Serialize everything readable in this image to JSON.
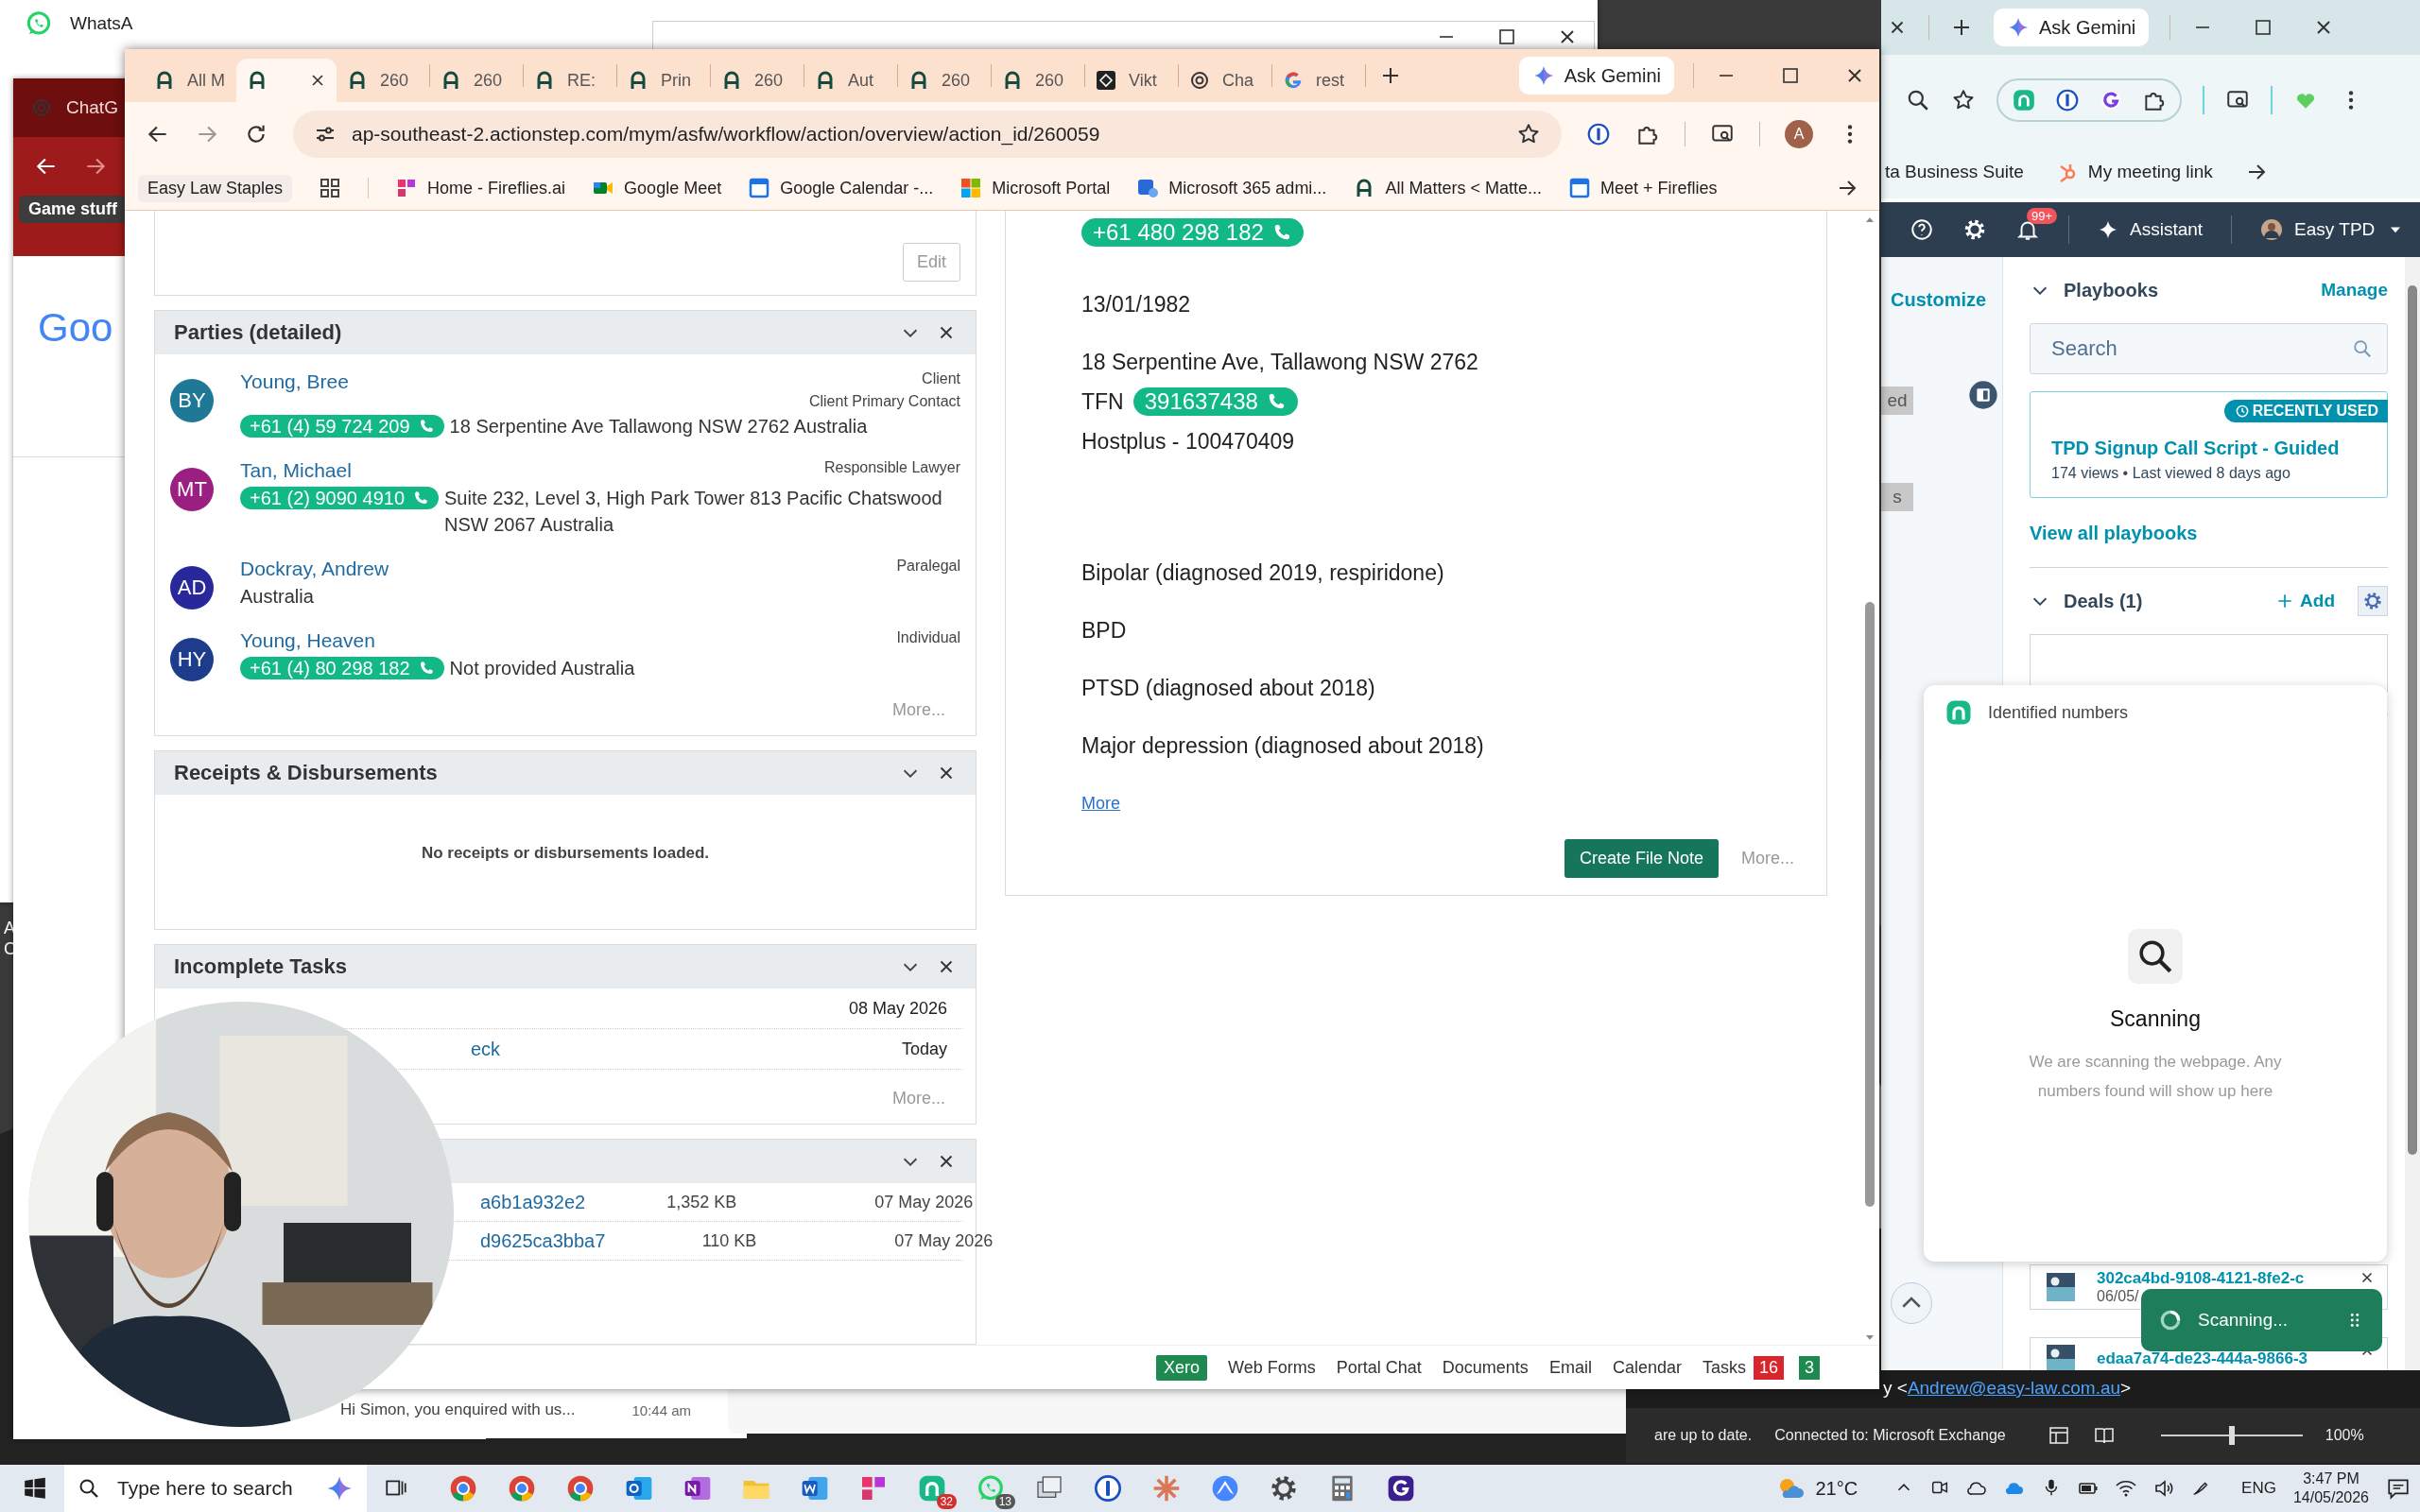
{
  "desktop": {
    "kind": "picture",
    "labels": [
      "A",
      "C"
    ]
  },
  "background_windows": {
    "whatsapp": {
      "title": "WhatsA",
      "message_preview": "Hi Simon, you enquired with us...",
      "time": "10:44 am"
    },
    "chatgpt": {
      "tab_title": "ChatG",
      "tooltip": "Game stuff",
      "logo_text": "Goo"
    },
    "outlook": {
      "sender_prefix": "y <",
      "email": "Andrew@easy-law.com.au",
      "sender_suffix": ">",
      "sync_status": "are up to date.",
      "connection": "Connected to: Microsoft Exchange",
      "zoom": "100%",
      "level": 0.5
    }
  },
  "main_browser": {
    "tabs": [
      {
        "title": "All M",
        "kind": "actionstep",
        "selected": false
      },
      {
        "kind": "actionstep",
        "selected": true
      },
      {
        "title": "260",
        "kind": "actionstep",
        "selected": false
      },
      {
        "title": "260",
        "kind": "actionstep",
        "selected": false
      },
      {
        "title": "RE:",
        "kind": "actionstep",
        "selected": false
      },
      {
        "title": "Prin",
        "kind": "actionstep",
        "selected": false
      },
      {
        "title": "260",
        "kind": "actionstep",
        "selected": false
      },
      {
        "title": "Aut",
        "kind": "actionstep",
        "selected": false
      },
      {
        "title": "260",
        "kind": "actionstep",
        "selected": false
      },
      {
        "title": "260",
        "kind": "actionstep",
        "selected": false
      },
      {
        "title": "Vikt",
        "kind": "dark",
        "selected": false
      },
      {
        "title": "Cha",
        "kind": "openai",
        "selected": false
      },
      {
        "title": "rest",
        "kind": "google",
        "selected": false
      }
    ],
    "gemini": "Ask Gemini",
    "address": "ap-southeast-2.actionstep.com/mym/asfw/workflow/action/overview/action_id/260059",
    "profile": "A",
    "bookmarks": [
      {
        "label": "Easy Law Staples"
      },
      {
        "kind": "apps"
      },
      {
        "label": "Home - Fireflies.ai",
        "kind": "fireflies"
      },
      {
        "label": "Google Meet",
        "kind": "meet"
      },
      {
        "label": "Google Calendar -...",
        "kind": "calendar"
      },
      {
        "label": "Microsoft Portal",
        "kind": "microsoft"
      },
      {
        "label": "Microsoft 365 admi...",
        "kind": "admin"
      },
      {
        "label": "All Matters < Matte...",
        "kind": "actionstep"
      },
      {
        "label": "Meet + Fireflies",
        "kind": "calendar"
      }
    ],
    "page": {
      "top_panel": {
        "button": "Edit"
      },
      "parties": {
        "title": "Parties (detailed)",
        "more": "More...",
        "items": [
          {
            "initials": "BY",
            "color": "#1f7896",
            "name": "Young, Bree",
            "phone": "+61 (4) 59 724 209",
            "address": "18 Serpentine Ave Tallawong NSW 2762 Australia",
            "roles": [
              "Client",
              "Client Primary Contact"
            ]
          },
          {
            "initials": "MT",
            "color": "#9b1f80",
            "name": "Tan, Michael",
            "phone": "+61 (2) 9090 4910",
            "address": "Suite 232, Level 3, High Park Tower 813 Pacific Chatswood NSW 2067 Australia",
            "roles": [
              "Responsible Lawyer"
            ]
          },
          {
            "initials": "AD",
            "color": "#28289a",
            "name": "Dockray, Andrew",
            "address": "Australia",
            "roles": [
              "Paralegal"
            ]
          },
          {
            "initials": "HY",
            "color": "#1e3c8c",
            "name": "Young, Heaven",
            "phone": "+61 (4) 80 298 182",
            "address": "Not provided Australia",
            "roles": [
              "Individual"
            ]
          }
        ]
      },
      "receipts": {
        "title": "Receipts & Disbursements",
        "empty": "No receipts or disbursements loaded."
      },
      "tasks": {
        "title": "Incomplete Tasks",
        "more": "More...",
        "rows": [
          {
            "date": "08 May 2026"
          },
          {
            "text": "eck",
            "date": "Today"
          }
        ]
      },
      "documents": {
        "rows": [
          {
            "name": "a6b1a932e2",
            "size": "1,352 KB",
            "date": "07 May 2026"
          },
          {
            "name": "d9625ca3bba7",
            "size": "110 KB",
            "date": "07 May 2026"
          }
        ]
      },
      "note": {
        "lines": [
          {
            "kind": "chip",
            "chip": "+61 480 298 182"
          },
          {
            "kind": "text",
            "text": "13/01/1982"
          },
          {
            "kind": "text",
            "text": "18 Serpentine Ave, Tallawong NSW 2762"
          },
          {
            "kind": "chip",
            "label": "TFN",
            "chip": "391637438"
          },
          {
            "kind": "text",
            "text": "Hostplus - 100470409"
          },
          {
            "kind": "section",
            "text": "Bipolar (diagnosed 2019, respiridone)"
          },
          {
            "kind": "text",
            "text": "BPD"
          },
          {
            "kind": "text",
            "text": "PTSD (diagnosed about 2018)"
          },
          {
            "kind": "text",
            "text": "Major depression (diagnosed about 2018)"
          }
        ],
        "link": "More",
        "button": "Create File Note",
        "more": "More..."
      },
      "footer": [
        {
          "label": "Xero",
          "kind": "button"
        },
        {
          "label": "Web Forms",
          "kind": "link"
        },
        {
          "label": "Portal Chat",
          "kind": "link"
        },
        {
          "label": "Documents",
          "kind": "link"
        },
        {
          "label": "Email",
          "kind": "link"
        },
        {
          "label": "Calendar",
          "kind": "link"
        },
        {
          "label": "Tasks",
          "kind": "link",
          "badges": [
            {
              "text": "16",
              "color": "#d8262c"
            },
            {
              "text": "3",
              "color": "#1f8a50"
            }
          ]
        }
      ]
    }
  },
  "side_browser": {
    "gemini": "Ask Gemini",
    "bookmarks": [
      {
        "label": "ta Business Suite"
      },
      {
        "label": "My meeting link",
        "kind": "hubspot"
      }
    ],
    "crm": {
      "notifications": "99+",
      "assistant": "Assistant",
      "account": "Easy TPD",
      "customize": "Customize",
      "chips": [
        "ed",
        "s"
      ],
      "playbooks": {
        "title": "Playbooks",
        "manage": "Manage",
        "placeholder": "Search",
        "badge": "RECENTLY USED",
        "card_title": "TPD Signup Call Script - Guided",
        "card_meta": "174 views • Last viewed 8 days ago",
        "view_all": "View all playbooks"
      },
      "deals": {
        "title": "Deals (1)",
        "add": "Add"
      },
      "files": [
        {
          "name": "302ca4bd-9108-4121-8fe2-c",
          "date": "06/05/"
        },
        {
          "name": "edaa7a74-de23-444a-9866-3"
        }
      ]
    },
    "popup": {
      "title": "Identified numbers",
      "heading": "Scanning",
      "text": "We are scanning the webpage. Any numbers found will show up here"
    },
    "toast": "Scanning..."
  },
  "taskbar": {
    "search_placeholder": "Type here to search",
    "apps": [
      {
        "kind": "chrome"
      },
      {
        "kind": "chrome"
      },
      {
        "kind": "chrome"
      },
      {
        "kind": "outlook"
      },
      {
        "kind": "onenote"
      },
      {
        "kind": "folder"
      },
      {
        "kind": "word"
      },
      {
        "kind": "fireflies"
      },
      {
        "kind": "greenapp",
        "badge": "32"
      },
      {
        "kind": "whatsapp",
        "badge": "13"
      },
      {
        "kind": "windows"
      },
      {
        "kind": "password"
      },
      {
        "kind": "asterisk"
      },
      {
        "kind": "nord"
      },
      {
        "kind": "settings"
      },
      {
        "kind": "calculator"
      },
      {
        "kind": "purple"
      }
    ],
    "weather": "21°C",
    "language": "ENG",
    "time": "3:47 PM",
    "date": "14/05/2026"
  }
}
